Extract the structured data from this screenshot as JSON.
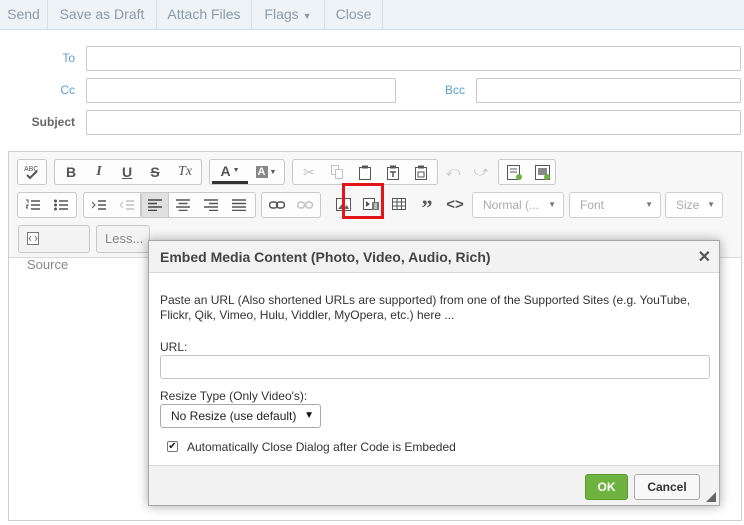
{
  "topbar": {
    "send": "Send",
    "save_draft": "Save as Draft",
    "attach_files": "Attach Files",
    "flags": "Flags",
    "close": "Close"
  },
  "header": {
    "to_label": "To",
    "cc_label": "Cc",
    "bcc_label": "Bcc",
    "subject_label": "Subject"
  },
  "toolbar": {
    "format_combo": "Normal (...",
    "font_combo": "Font",
    "size_combo": "Size",
    "source_label": "Source",
    "less_label": "Less...",
    "icons": {
      "spellcheck": "ABC",
      "bold": "B",
      "italic": "I",
      "underline": "U",
      "strike": "S",
      "remove_format": "Tx",
      "text_color": "A",
      "bg_color": "A"
    }
  },
  "dialog": {
    "title": "Embed Media Content (Photo, Video, Audio, Rich)",
    "close_icon": "✕",
    "intro": "Paste an URL (Also shortened URLs are supported) from one of the Supported Sites (e.g. YouTube, Flickr, Qik, Vimeo, Hulu, Viddler, MyOpera, etc.) here ...",
    "url_label": "URL:",
    "url_value": "",
    "resize_label": "Resize Type (Only Video's):",
    "resize_value": "No Resize (use default)",
    "auto_close_label": "Automatically Close Dialog after Code is Embeded",
    "auto_close_checked": true,
    "ok": "OK",
    "cancel": "Cancel"
  },
  "colors": {
    "ok_green": "#6eb33f",
    "highlight_red": "#e3151a",
    "label_blue": "#5a9fd6"
  }
}
